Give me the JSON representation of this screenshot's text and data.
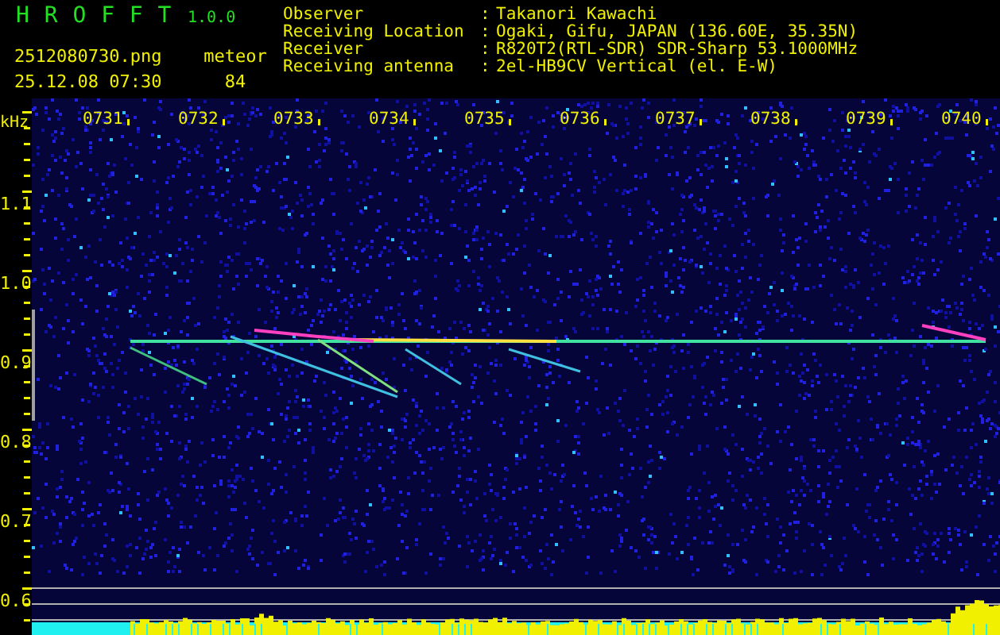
{
  "app": {
    "title": "H R O F F T",
    "version": "1.0.0",
    "file": "2512080730.png",
    "datetime": "25.12.08 07:30",
    "counter_label": "meteor",
    "counter": "84"
  },
  "station": [
    {
      "label": "Observer",
      "separator": ":",
      "value": "Takanori Kawachi"
    },
    {
      "label": "Receiving Location",
      "separator": ":",
      "value": "Ogaki, Gifu, JAPAN (136.60E, 35.35N)"
    },
    {
      "label": "Receiver",
      "separator": ":",
      "value": "R820T2(RTL-SDR) SDR-Sharp 53.1000MHz"
    },
    {
      "label": "Receiving antenna",
      "separator": ":",
      "value": "2el-HB9CV Vertical (el. E-W)"
    }
  ],
  "plot": {
    "unit": "kHz",
    "time_labels": [
      "0731",
      "0732",
      "0733",
      "0734",
      "0735",
      "0736",
      "0737",
      "0738",
      "0739",
      "0740"
    ],
    "freq_labels": [
      "1.1",
      "1.0",
      "0.9",
      "0.8",
      "0.7",
      "0.6"
    ]
  }
}
